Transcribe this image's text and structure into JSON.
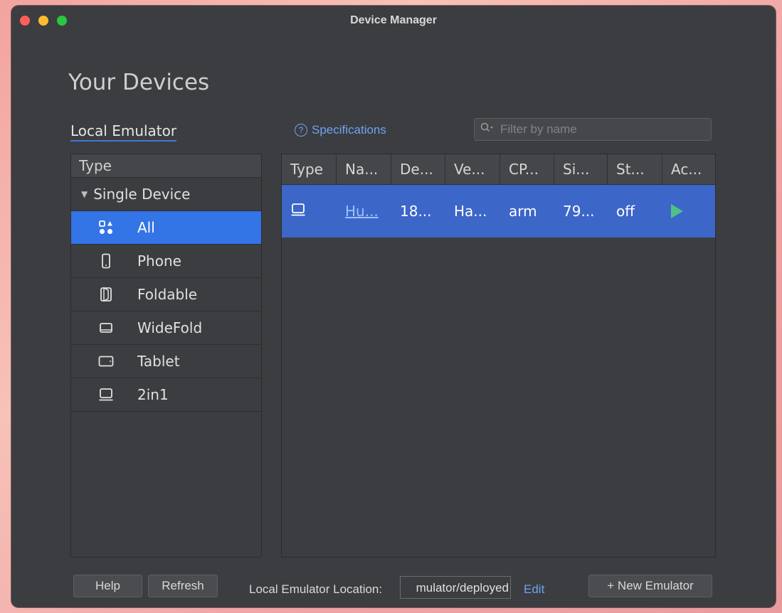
{
  "window": {
    "title": "Device Manager"
  },
  "heading": "Your Devices",
  "tabs": {
    "local_emulator": "Local Emulator"
  },
  "specifications_link": "Specifications",
  "filter": {
    "placeholder": "Filter by name"
  },
  "type_panel": {
    "header": "Type",
    "group": "Single Device",
    "items": [
      {
        "label": "All",
        "icon": "all-devices-icon",
        "selected": true
      },
      {
        "label": "Phone",
        "icon": "phone-icon"
      },
      {
        "label": "Foldable",
        "icon": "foldable-icon"
      },
      {
        "label": "WideFold",
        "icon": "widefold-icon"
      },
      {
        "label": "Tablet",
        "icon": "tablet-icon"
      },
      {
        "label": "2in1",
        "icon": "2in1-icon"
      }
    ]
  },
  "table": {
    "columns": [
      "Type",
      "Na...",
      "De...",
      "Ve...",
      "CP...",
      "Si...",
      "St...",
      "Ac..."
    ],
    "rows": [
      {
        "type_icon": "2in1-icon",
        "name": "Hu...",
        "device": "18...",
        "version": "Ha...",
        "cpu": "arm",
        "size": "79...",
        "status": "off",
        "action_icon": "play-icon"
      }
    ]
  },
  "bottom": {
    "help": "Help",
    "refresh": "Refresh",
    "location_label": "Local Emulator Location:",
    "location_value": "mulator/deployed",
    "edit": "Edit",
    "new_emulator": "+ New Emulator"
  },
  "colors": {
    "accent": "#3374e6",
    "selected_row": "#3d66c9",
    "link": "#6ea3f4",
    "play": "#4fc186"
  }
}
